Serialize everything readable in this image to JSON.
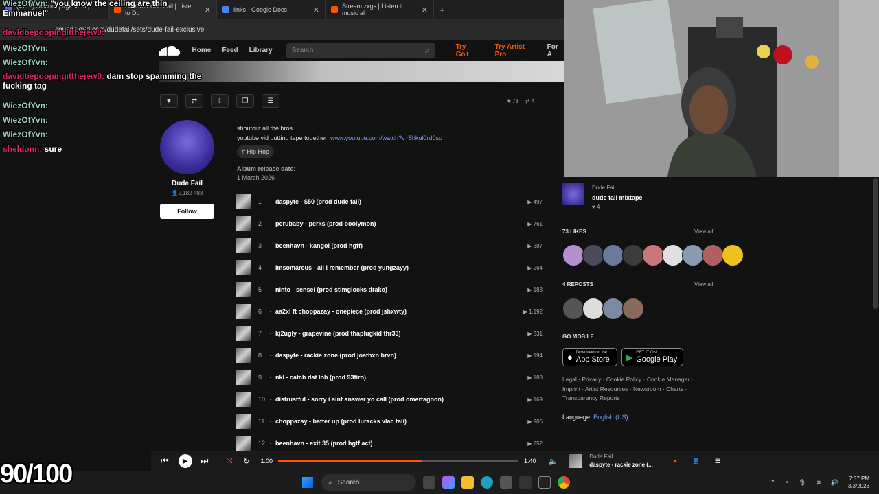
{
  "browser": {
    "tabs": [
      {
        "label": "(4172) Discord | #general | Perc",
        "color": "#5865f2"
      },
      {
        "label": "Stream Dude Fail | Listen to Du",
        "color": "#ff5500"
      },
      {
        "label": "links - Google Docs",
        "color": "#4285f4"
      },
      {
        "label": "Stream zxgs | Listen to music al",
        "color": "#ff5500"
      }
    ],
    "new_tab": "+",
    "url": "soundcloud.com/dudefail/sets/dude-fail-exclusive"
  },
  "header": {
    "nav": [
      "Home",
      "Feed",
      "Library"
    ],
    "search_placeholder": "Search",
    "try_go": "Try Go+",
    "try_artist": "Try Artist Pro",
    "for_artists": "For A"
  },
  "actions": {
    "likes": "73",
    "reposts": "4"
  },
  "artist": {
    "name": "Dude Fail",
    "followers": "2,182",
    "tracks": "83",
    "follow_label": "Follow"
  },
  "description": {
    "line1": "shoutout all the bros",
    "line2_prefix": "youtube vid putting tape together: ",
    "line2_link": "www.youtube.com/watch?v=5hkul0rd0so",
    "tag": "# Hip Hop",
    "release_label": "Album release date:",
    "release_date": "1 March 2026"
  },
  "tracks": [
    {
      "num": "1",
      "title": "daspyte - $50 (prod dude fail)",
      "plays": "497"
    },
    {
      "num": "2",
      "title": "perubaby - perks (prod boolymon)",
      "plays": "761"
    },
    {
      "num": "3",
      "title": "beenhavn - kangol (prod hgtf)",
      "plays": "387"
    },
    {
      "num": "4",
      "title": "imsomarcus - all i remember (prod yungzayy)",
      "plays": "264"
    },
    {
      "num": "5",
      "title": "ninto - sensei (prod stimglocks drako)",
      "plays": "188"
    },
    {
      "num": "6",
      "title": "aa2xl ft choppazay - onepiece (prod jshxwty)",
      "plays": "1,192"
    },
    {
      "num": "7",
      "title": "kj2ugly - grapevine (prod thaplugkid thr33)",
      "plays": "331"
    },
    {
      "num": "8",
      "title": "daspyte - rackie zone (prod joathxn brvn)",
      "plays": "194"
    },
    {
      "num": "9",
      "title": "nkl - catch dat lob (prod 93firo)",
      "plays": "188"
    },
    {
      "num": "10",
      "title": "distrustful - sorry i aint answer yo call (prod omertagoon)",
      "plays": "169"
    },
    {
      "num": "11",
      "title": "choppazay - batter up (prod luracks vlac tali)",
      "plays": "906"
    },
    {
      "num": "12",
      "title": "beenhavn - exit 35 (prod hgtf act)",
      "plays": "252"
    }
  ],
  "sidebar": {
    "related_artist": "Dude Fail",
    "related_title": "dude fail mixtape",
    "related_likes": "4",
    "likes_heading": "73 LIKES",
    "reposts_heading": "4 REPOSTS",
    "view_all": "View all",
    "go_mobile": "GO MOBILE",
    "app_store_small": "Download on the",
    "app_store_big": "App Store",
    "google_small": "GET IT ON",
    "google_big": "Google Play",
    "footer_line1": "Legal · Privacy · Cookie Policy · Cookie Manager ·",
    "footer_line2": "Imprint · Artist Resources · Newsroom · Charts ·",
    "footer_line3": "Transparency Reports",
    "language_label": "Language:",
    "language_value": "English (US)",
    "like_colors": [
      "#b58fd0",
      "#4a4a5a",
      "#6a7a9a",
      "#3c3c3c",
      "#c87878",
      "#e0e0e0",
      "#8a9ab0",
      "#b06060",
      "#f0c020"
    ],
    "repost_colors": [
      "#555",
      "#ddd",
      "#7a8aa0",
      "#8a6a5a"
    ]
  },
  "chat": [
    {
      "user": "WiezOfYvn:",
      "msg": " \"you know the ceiling are thin Emmanuel\"",
      "color": "#9fd1c0"
    },
    {
      "user": "davidbepoppingitthejew0:",
      "msg": "",
      "color": "#e0245e"
    },
    {
      "user": "WiezOfYvn:",
      "msg": "",
      "color": "#9fd1c0"
    },
    {
      "user": "WiezOfYvn:",
      "msg": "",
      "color": "#9fd1c0"
    },
    {
      "user": "davidbepoppingitthejew0:",
      "msg": " dam  stop spamming the fucking tag",
      "color": "#e0245e"
    },
    {
      "user": "WiezOfYvn:",
      "msg": "",
      "color": "#9fd1c0"
    },
    {
      "user": "WiezOfYvn:",
      "msg": "",
      "color": "#9fd1c0"
    },
    {
      "user": "WiezOfYvn:",
      "msg": "",
      "color": "#9fd1c0"
    },
    {
      "user": "sheldonn:",
      "msg": " sure",
      "color": "#e0245e"
    }
  ],
  "player": {
    "elapsed": "1:00",
    "total": "1:40",
    "progress_fraction": 0.6,
    "artist": "Dude Fail",
    "title": "daspyte - rackie zone (..."
  },
  "overlay_score": "90/100",
  "taskbar": {
    "search": "Search",
    "time": "7:57 PM",
    "date": "3/3/2026"
  }
}
